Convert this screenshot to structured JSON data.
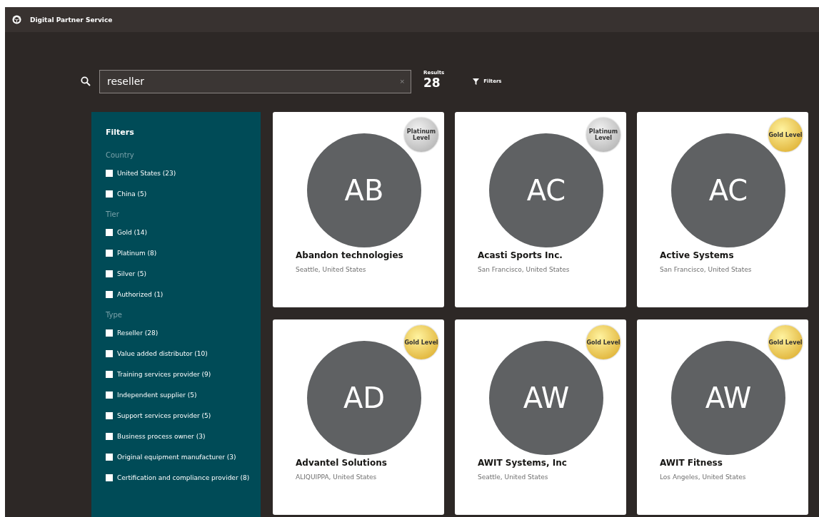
{
  "app": {
    "title": "Digital Partner Service"
  },
  "search": {
    "value": "reseller",
    "clear": "×"
  },
  "results": {
    "label": "Results",
    "count": "28"
  },
  "filters_button": {
    "label": "Filters"
  },
  "filter_panel": {
    "title": "Filters",
    "groups": [
      {
        "heading": "Country",
        "options": [
          {
            "label": "United States (23)",
            "checked": false
          },
          {
            "label": "China (5)",
            "checked": false
          }
        ]
      },
      {
        "heading": "Tier",
        "options": [
          {
            "label": "Gold (14)",
            "checked": false
          },
          {
            "label": "Platinum (8)",
            "checked": false
          },
          {
            "label": "Silver (5)",
            "checked": false
          },
          {
            "label": "Authorized (1)",
            "checked": false
          }
        ]
      },
      {
        "heading": "Type",
        "options": [
          {
            "label": "Reseller (28)",
            "checked": false
          },
          {
            "label": "Value added distributor (10)",
            "checked": false
          },
          {
            "label": "Training services provider (9)",
            "checked": false
          },
          {
            "label": "Independent supplier (5)",
            "checked": false
          },
          {
            "label": "Support services provider (5)",
            "checked": false
          },
          {
            "label": "Business process owner (3)",
            "checked": false
          },
          {
            "label": "Original equipment manufacturer (3)",
            "checked": false
          },
          {
            "label": "Certification and compliance provider (8)",
            "checked": false
          }
        ]
      }
    ]
  },
  "partners": [
    {
      "initials": "AB",
      "name": "Abandon technologies",
      "location": "Seattle, United States",
      "badge": {
        "kind": "platinum",
        "label": "Platinum Level"
      }
    },
    {
      "initials": "AC",
      "name": "Acasti Sports Inc.",
      "location": "San Francisco, United States",
      "badge": {
        "kind": "platinum",
        "label": "Platinum Level"
      }
    },
    {
      "initials": "AC",
      "name": "Active Systems",
      "location": "San Francisco, United States",
      "badge": {
        "kind": "gold",
        "label": "Gold Level"
      }
    },
    {
      "initials": "AD",
      "name": "Advantel Solutions",
      "location": "ALIQUIPPA, United States",
      "badge": {
        "kind": "gold",
        "label": "Gold Level"
      }
    },
    {
      "initials": "AW",
      "name": "AWIT Systems, Inc",
      "location": "Seattle, United States",
      "badge": {
        "kind": "gold",
        "label": "Gold Level"
      }
    },
    {
      "initials": "AW",
      "name": "AWIT Fitness",
      "location": "Los Angeles, United States",
      "badge": {
        "kind": "gold",
        "label": "Gold Level"
      }
    }
  ]
}
